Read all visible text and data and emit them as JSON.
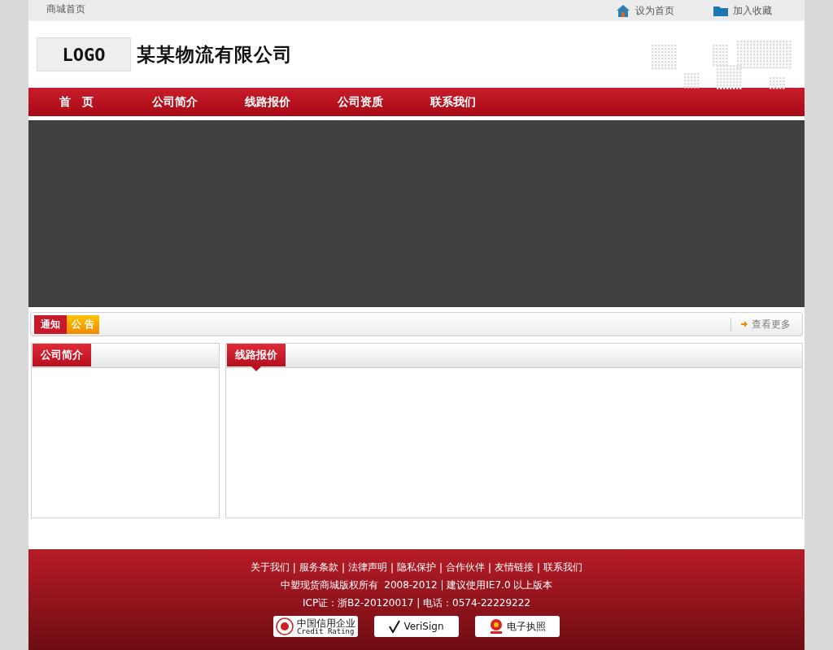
{
  "top_bar": {
    "home_link": "商城首页",
    "actions": [
      {
        "kind": "home",
        "label": "设为首页"
      },
      {
        "kind": "folder",
        "label": "加入收藏"
      }
    ]
  },
  "header": {
    "logo": "LOGO",
    "company": "某某物流有限公司"
  },
  "nav": [
    "首　页",
    "公司简介",
    "线路报价",
    "公司资质",
    "联系我们"
  ],
  "notice": {
    "tag_1": "通知",
    "tag_2": "公 告",
    "more": "查看更多"
  },
  "panels": [
    {
      "title": "公司简介",
      "pointer": false
    },
    {
      "title": "线路报价",
      "pointer": true
    }
  ],
  "footer": {
    "separator": "|",
    "links": [
      "关于我们",
      "服务条款",
      "法律声明",
      "隐私保护",
      "合作伙伴",
      "友情链接",
      "联系我们"
    ],
    "copyright": "中塑现货商城版权所有  2008-2012 | 建议使用IE7.0 以上版本",
    "icp": "ICP证：浙B2-20120017 | 电话：0574-22229222",
    "badges": [
      {
        "kind": "credit",
        "title": "中国信用企业",
        "subtitle": "Credit Rating"
      },
      {
        "kind": "verisign",
        "title": "VeriSign"
      },
      {
        "kind": "license",
        "title": "电子执照"
      }
    ]
  }
}
